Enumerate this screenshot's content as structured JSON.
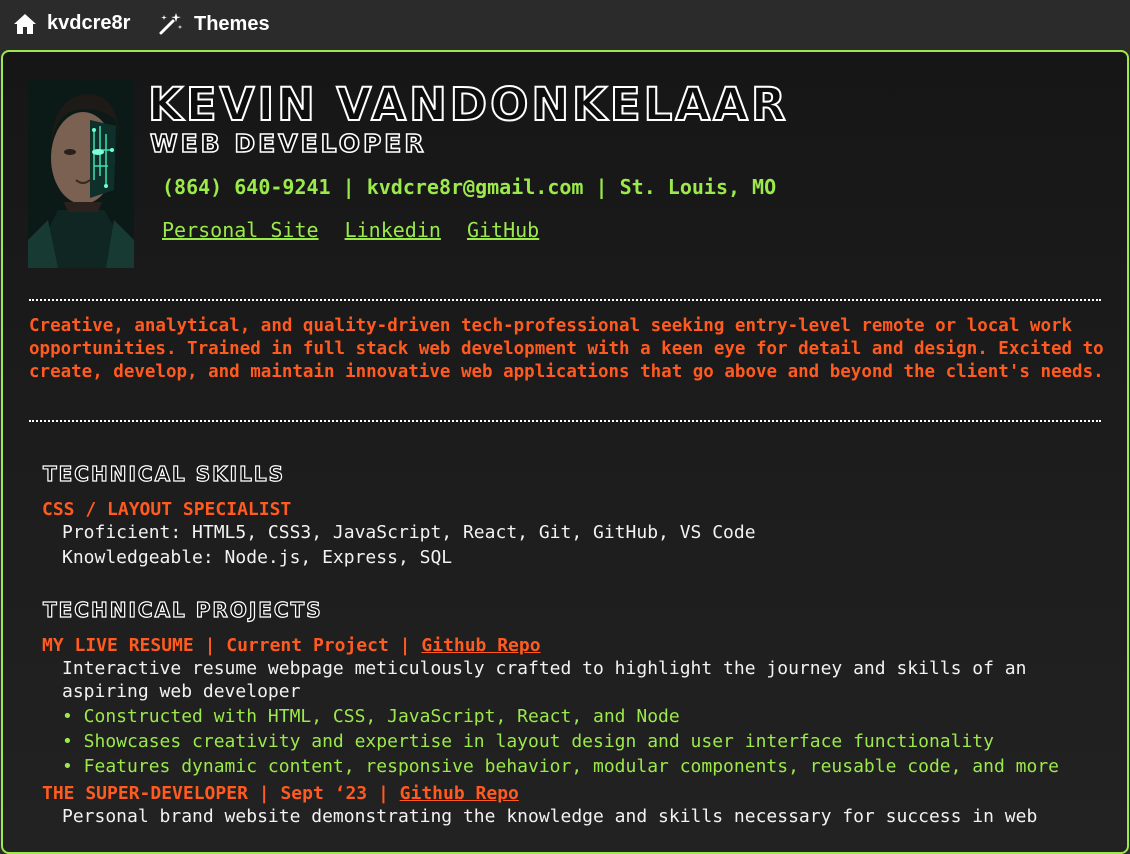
{
  "nav": {
    "home_label": "kvdcre8r",
    "themes_label": "Themes",
    "home_icon": "home-icon",
    "themes_icon": "magic-wand-icon"
  },
  "header": {
    "name": "KEVIN VANDONKELAAR",
    "role": "WEB DEVELOPER",
    "phone": "(864) 640-9241",
    "email": "kvdcre8r@gmail.com",
    "location": "St. Louis, MO",
    "separator": "|",
    "links": [
      "Personal Site",
      "Linkedin",
      "GitHub"
    ]
  },
  "summary": "Creative, analytical, and quality-driven tech-professional seeking entry-level remote or local work opportunities. Trained in full stack web development with a keen eye for detail and design. Excited to create, develop, and maintain innovative web applications that go above and beyond the client's needs.",
  "skills": {
    "heading": "TECHNICAL SKILLS",
    "subheading": "CSS / LAYOUT SPECIALIST",
    "proficient": "Proficient: HTML5, CSS3, JavaScript, React, Git, GitHub, VS Code",
    "knowledgeable": "Knowledgeable: Node.js, Express, SQL"
  },
  "projects": {
    "heading": "TECHNICAL PROJECTS",
    "items": [
      {
        "title": "MY LIVE RESUME",
        "date": "Current Project",
        "link": "Github Repo",
        "description_1": "Interactive resume webpage meticulously crafted to highlight the journey and skills of an",
        "description_2": "aspiring web developer",
        "bullets": [
          "• Constructed with HTML, CSS, JavaScript, React, and Node",
          "• Showcases creativity and expertise in layout design and user interface functionality",
          "• Features dynamic content, responsive behavior, modular components, reusable code, and more"
        ]
      },
      {
        "title": "THE SUPER-DEVELOPER",
        "date": "Sept ‘23",
        "link": "Github Repo",
        "description_1": "Personal brand website demonstrating the knowledge and skills necessary for success in web"
      }
    ]
  },
  "colors": {
    "accent_green": "#9be94a",
    "accent_orange": "#ff5a1f",
    "background": "#2b2b2b"
  }
}
